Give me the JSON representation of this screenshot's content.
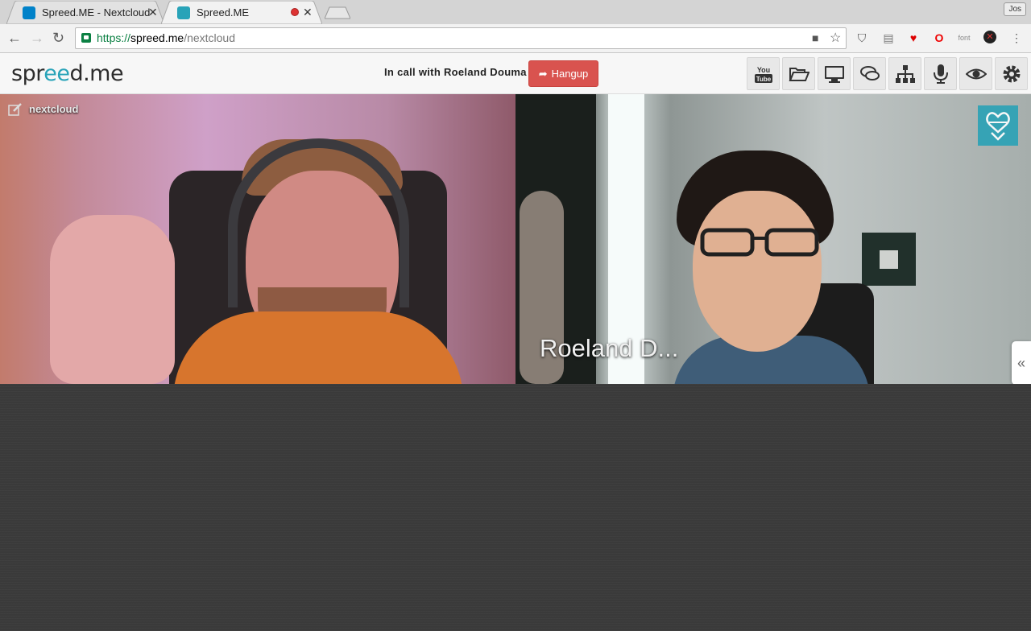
{
  "browser": {
    "tabs": [
      {
        "title": "Spreed.ME - Nextcloud",
        "active": false
      },
      {
        "title": "Spreed.ME",
        "active": true
      }
    ],
    "user_label": "Jos",
    "url": {
      "scheme": "https://",
      "host": "spreed.me",
      "path": "/nextcloud"
    },
    "extensions": [
      "pocket-icon",
      "printer-icon",
      "heart-icon",
      "opera-icon",
      "font-icon",
      "block-icon"
    ]
  },
  "app": {
    "logo": {
      "part1": "spr",
      "part2": "ee",
      "part3": "d.me"
    },
    "status_text": "In call with Roeland Douma",
    "hangup_label": "Hangup",
    "toolbar_icons": [
      "youtube-icon",
      "folder-icon",
      "screenshare-icon",
      "chat-icon",
      "network-icon",
      "microphone-icon",
      "eye-icon",
      "settings-icon"
    ],
    "accent": "#28a3b8",
    "hangup_color": "#d9534f"
  },
  "videos": {
    "local_label": "nextcloud",
    "remote_label": "Roeland D..."
  },
  "sidebar_toggle": "«"
}
